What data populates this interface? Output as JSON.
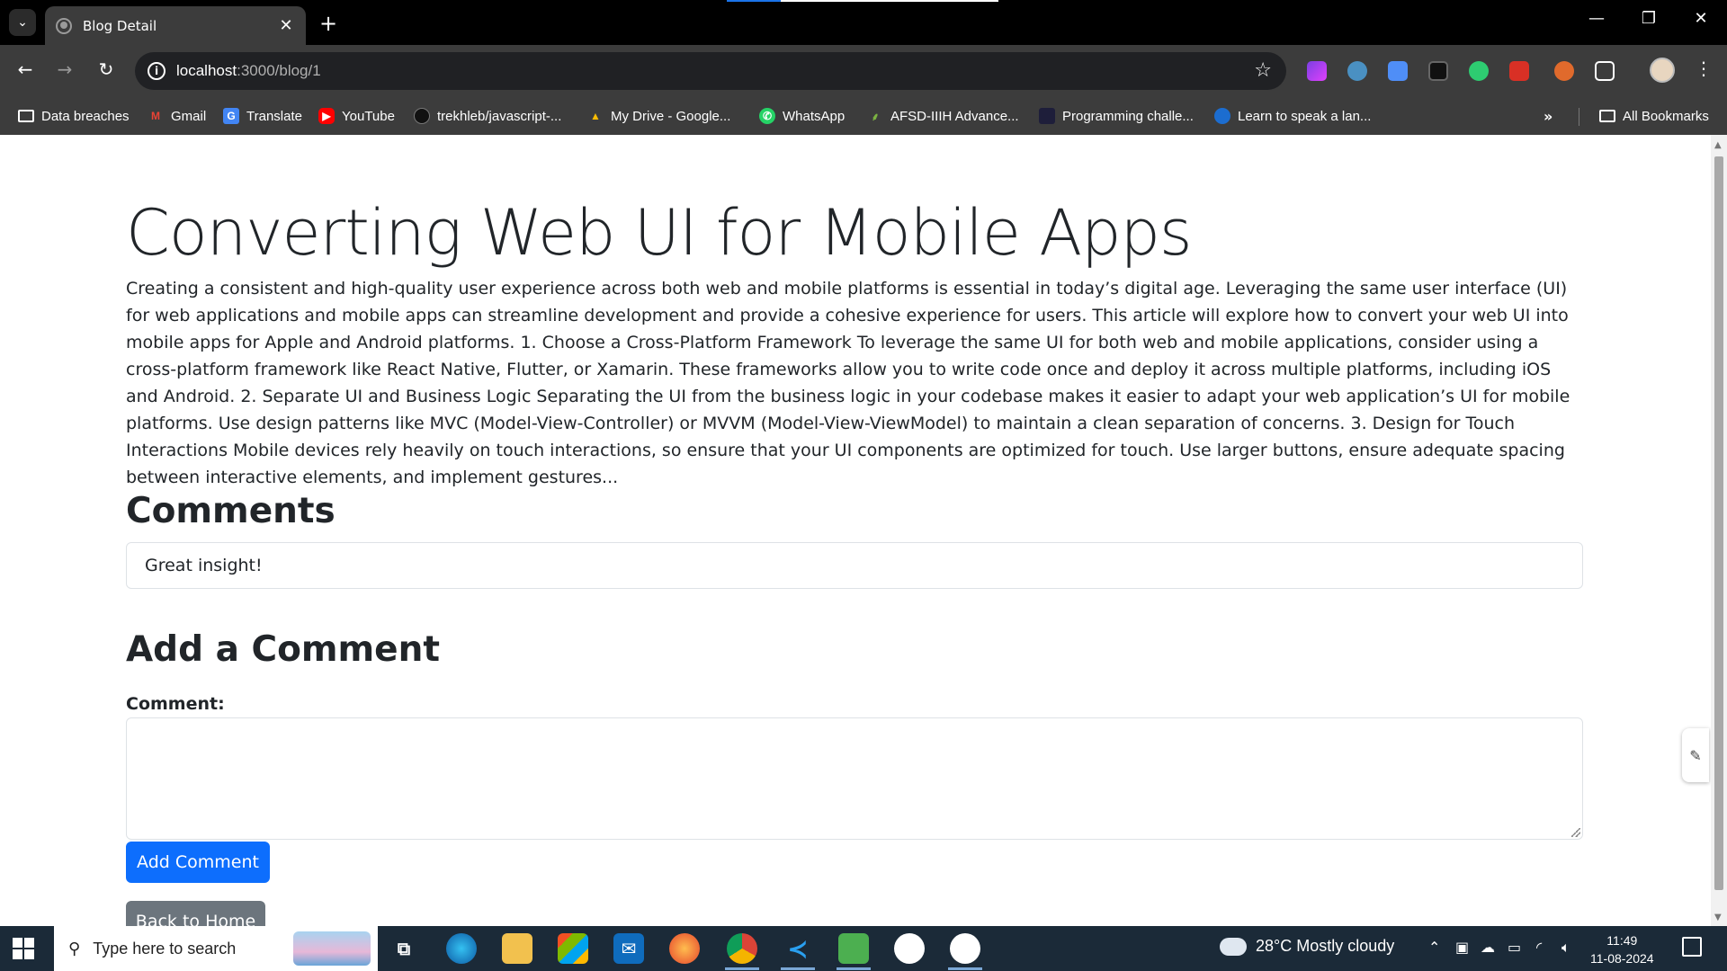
{
  "browser": {
    "tab_title": "Blog Detail",
    "url_host": "localhost",
    "url_path": ":3000/blog/1",
    "bookmarks": [
      {
        "label": "Data breaches",
        "icon": "folder-icon"
      },
      {
        "label": "Gmail",
        "icon": "gmail-icon"
      },
      {
        "label": "Translate",
        "icon": "translate-icon"
      },
      {
        "label": "YouTube",
        "icon": "youtube-icon"
      },
      {
        "label": "trekhleb/javascript-...",
        "icon": "github-icon"
      },
      {
        "label": "My Drive - Google...",
        "icon": "google-drive-icon"
      },
      {
        "label": "WhatsApp",
        "icon": "whatsapp-icon"
      },
      {
        "label": "AFSD-IIIH Advance...",
        "icon": "leaf-icon"
      },
      {
        "label": "Programming challe...",
        "icon": "code-icon"
      },
      {
        "label": "Learn to speak a lan...",
        "icon": "duolingo-icon"
      }
    ],
    "all_bookmarks": "All Bookmarks"
  },
  "page": {
    "title": "Converting Web UI for Mobile Apps",
    "body": "Creating a consistent and high-quality user experience across both web and mobile platforms is essential in today’s digital age. Leveraging the same user interface (UI) for web applications and mobile apps can streamline development and provide a cohesive experience for users. This article will explore how to convert your web UI into mobile apps for Apple and Android platforms. 1. Choose a Cross-Platform Framework To leverage the same UI for both web and mobile applications, consider using a cross-platform framework like React Native, Flutter, or Xamarin. These frameworks allow you to write code once and deploy it across multiple platforms, including iOS and Android. 2. Separate UI and Business Logic Separating the UI from the business logic in your codebase makes it easier to adapt your web application’s UI for mobile platforms. Use design patterns like MVC (Model-View-Controller) or MVVM (Model-View-ViewModel) to maintain a clean separation of concerns. 3. Design for Touch Interactions Mobile devices rely heavily on touch interactions, so ensure that your UI components are optimized for touch. Use larger buttons, ensure adequate spacing between interactive elements, and implement gestures...",
    "comments_heading": "Comments",
    "comments": [
      "Great insight!"
    ],
    "add_heading": "Add a Comment",
    "comment_label": "Comment:",
    "comment_value": "",
    "add_button": "Add Comment",
    "back_button": "Back to Home"
  },
  "taskbar": {
    "search_placeholder": "Type here to search",
    "weather": "28°C  Mostly cloudy",
    "time": "11:49",
    "date": "11-08-2024"
  },
  "colors": {
    "primary": "#0d6efd",
    "secondary": "#6c757d",
    "chrome_dark": "#3c3c3c",
    "taskbar": "#1b2a38"
  }
}
